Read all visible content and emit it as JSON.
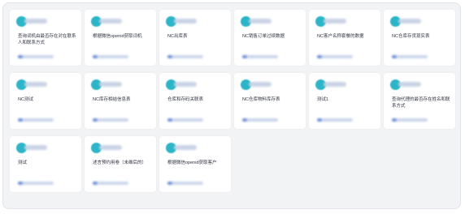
{
  "cards": [
    {
      "title": "查询词机由最否存在对在联系人和联系方式"
    },
    {
      "title": "根据微信openid获取词机"
    },
    {
      "title": "NC出库表"
    },
    {
      "title": "NC销售订单过续数据"
    },
    {
      "title": "NC客户名称套餐的数据"
    },
    {
      "title": "NC仓库存货现实表"
    },
    {
      "title": "NC测试"
    },
    {
      "title": "NC库存相结信息表"
    },
    {
      "title": "仓库和存码关联表"
    },
    {
      "title": "NC仓库物料库存表"
    },
    {
      "title": "测试1"
    },
    {
      "title": "查询代理的最否存在姓名和联系方式"
    },
    {
      "title": "测试"
    },
    {
      "title": "述言预约用卷（未维后的）"
    },
    {
      "title": "根据微信openid获取客户"
    }
  ],
  "icons": {
    "collapse": "chevron-up-icon"
  }
}
